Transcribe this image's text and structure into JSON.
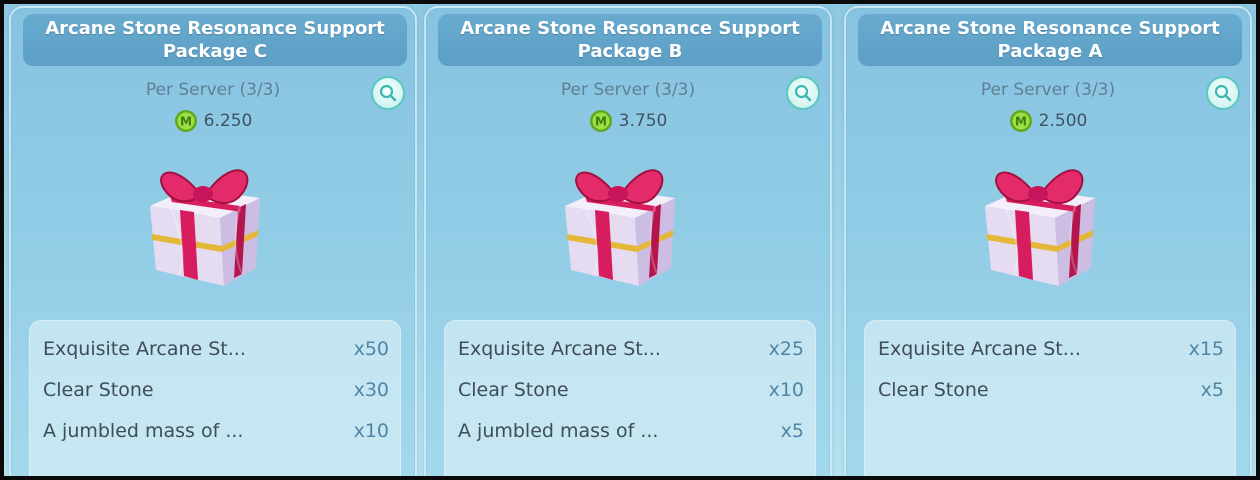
{
  "cards": [
    {
      "title": "Arcane Stone Resonance Support Package C",
      "limit": "Per Server (3/3)",
      "price": "6.250",
      "items": [
        {
          "name": "Exquisite Arcane St...",
          "qty": "x50"
        },
        {
          "name": "Clear Stone",
          "qty": "x30"
        },
        {
          "name": "A jumbled mass of ...",
          "qty": "x10"
        }
      ]
    },
    {
      "title": "Arcane Stone Resonance Support Package B",
      "limit": "Per Server (3/3)",
      "price": "3.750",
      "items": [
        {
          "name": "Exquisite Arcane St...",
          "qty": "x25"
        },
        {
          "name": "Clear Stone",
          "qty": "x10"
        },
        {
          "name": "A jumbled mass of ...",
          "qty": "x5"
        }
      ]
    },
    {
      "title": "Arcane Stone Resonance Support Package A",
      "limit": "Per Server (3/3)",
      "price": "2.500",
      "items": [
        {
          "name": "Exquisite Arcane St...",
          "qty": "x15"
        },
        {
          "name": "Clear Stone",
          "qty": "x5"
        }
      ]
    }
  ],
  "icons": {
    "currency": "m-coin-icon",
    "inspect": "magnifier-icon",
    "package": "gift-box-icon"
  },
  "colors": {
    "header_bg": "#62a5cb",
    "card_bg": "#8fcae4",
    "coin": "#8bd13a",
    "ribbon": "#d81d5e",
    "box": "#e9e0f4",
    "inspect_ring": "#59c7c0"
  }
}
